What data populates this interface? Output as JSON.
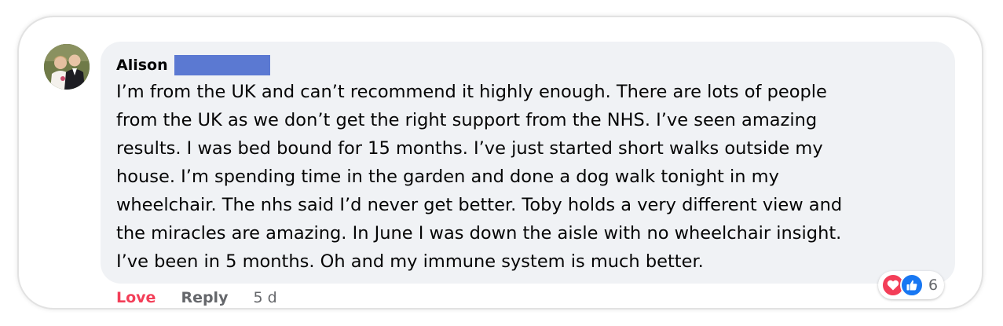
{
  "comment": {
    "author": "Alison",
    "text": "I’m from the UK and can’t recommend it highly enough. There are lots of people\nfrom the UK as we don’t get the right support from the NHS. I’ve seen amazing\nresults. I was bed bound for 15 months. I’ve just started short walks outside my\nhouse. I’m spending time in the garden and done a dog walk tonight in my\nwheelchair. The nhs said I’d never get better. Toby holds a very different view and\nthe miracles are amazing. In June I was down the aisle with no wheelchair insight.\nI’ve been in 5 months. Oh and my immune system is much better."
  },
  "actions": {
    "love_label": "Love",
    "reply_label": "Reply",
    "timestamp": "5 d"
  },
  "reactions": {
    "icons": [
      "heart-icon",
      "thumbs-up-icon"
    ],
    "count": "6"
  },
  "colors": {
    "bubble": "#f0f2f5",
    "love": "#f33e58",
    "like": "#1877f2",
    "redaction": "#5b79d2",
    "secondary_text": "#65676b"
  }
}
